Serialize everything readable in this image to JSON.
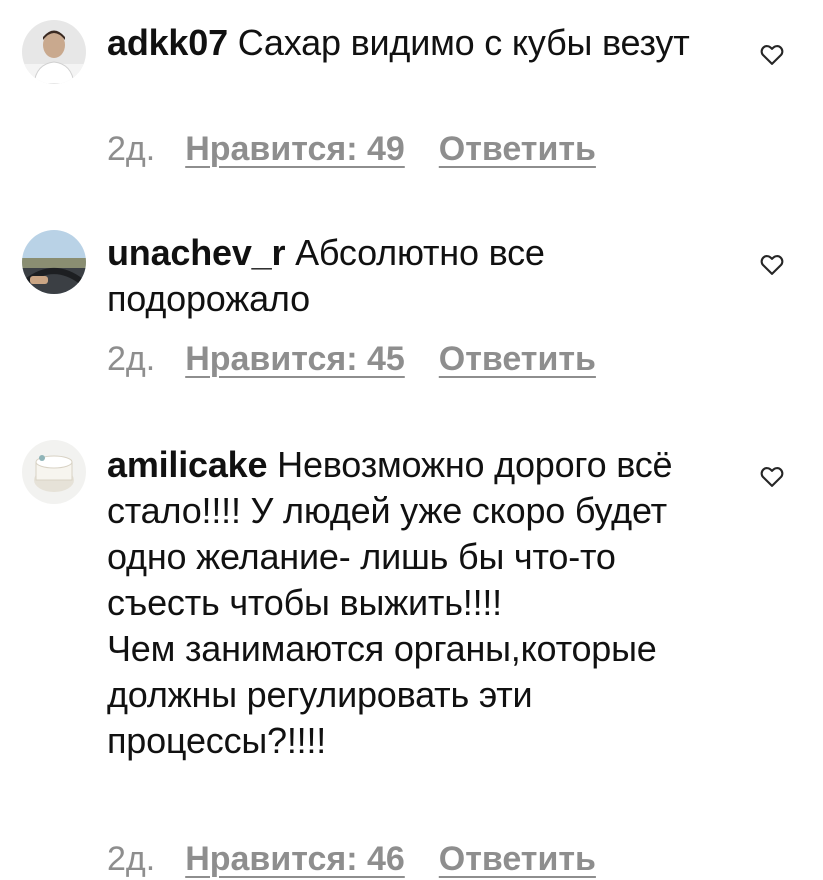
{
  "comments": [
    {
      "username": "adkk07",
      "text": "Сахар видимо с кубы везут",
      "time": "2д.",
      "likes": "Нравится: 49",
      "reply": "Ответить"
    },
    {
      "username": "unachev_r",
      "text": "Абсолютно все подорожало",
      "time": "2д.",
      "likes": "Нравится: 45",
      "reply": "Ответить"
    },
    {
      "username": "amilicake",
      "text": "Невозможно дорого всё стало!!!! У людей уже скоро будет одно желание- лишь бы что-то съесть чтобы выжить!!!!",
      "text_line2": "Чем занимаются органы,которые должны регулировать эти процессы?!!!!",
      "time": "2д.",
      "likes": "Нравится: 46",
      "reply": "Ответить"
    }
  ],
  "icons": {
    "like": "heart-outline-icon"
  },
  "colors": {
    "text": "#111111",
    "meta": "#8e8e8e",
    "background": "#ffffff"
  }
}
